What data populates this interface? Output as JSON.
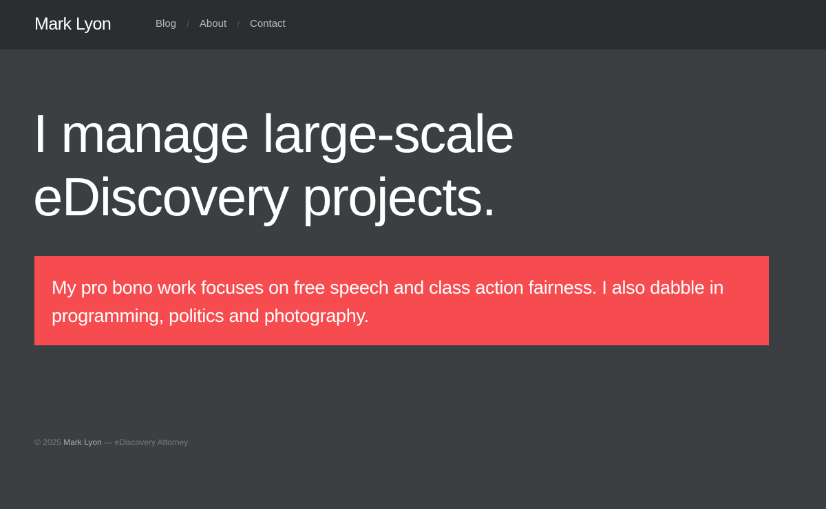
{
  "navbar": {
    "brand": "Mark Lyon",
    "links": [
      {
        "label": "Blog"
      },
      {
        "label": "About"
      },
      {
        "label": "Contact"
      }
    ],
    "separator": "/"
  },
  "hero": {
    "headline_line1": "I manage large-scale",
    "headline_line2": "eDiscovery projects."
  },
  "callout": {
    "text": "My pro bono work focuses on free speech and class action fairness. I also dabble in programming, politics and photography.",
    "background_color": "#f64c4f"
  },
  "footer": {
    "copyright": "© 2025",
    "name": "Mark Lyon",
    "suffix": "— eDiscovery Attorney"
  }
}
